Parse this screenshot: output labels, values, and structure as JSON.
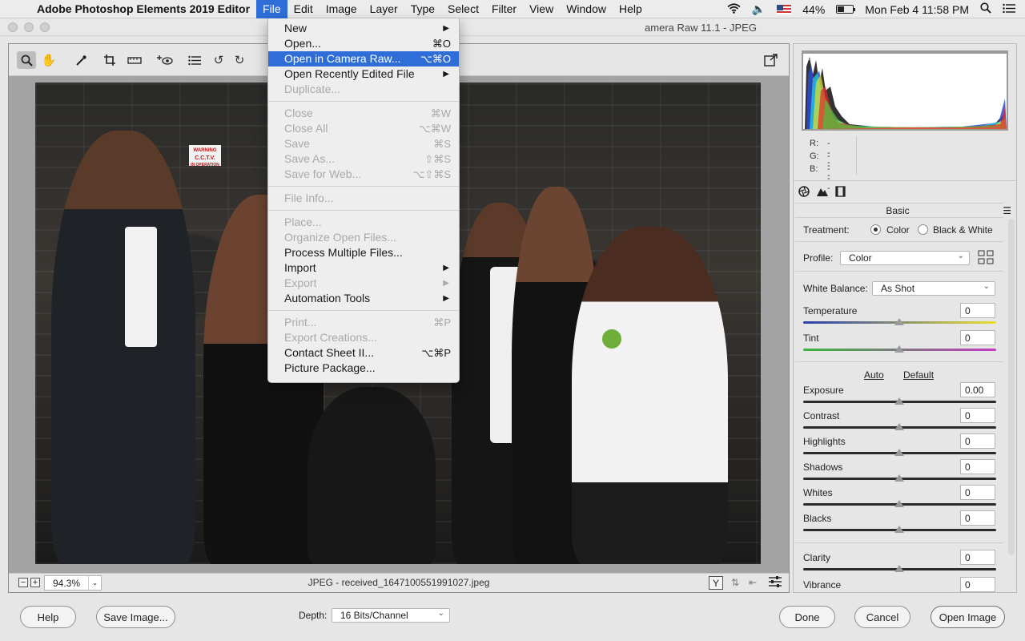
{
  "menubar": {
    "app_name": "Adobe Photoshop Elements 2019 Editor",
    "menus": [
      "File",
      "Edit",
      "Image",
      "Layer",
      "Type",
      "Select",
      "Filter",
      "View",
      "Window",
      "Help"
    ],
    "battery": "44%",
    "clock": "Mon Feb 4  11:58 PM"
  },
  "window": {
    "title": "Camera Raw 11.1  -  JPEG",
    "title_visible": "amera Raw 11.1  -  JPEG"
  },
  "photo": {
    "sign_line1": "WARNING",
    "sign_line2": "C.C.T.V.",
    "sign_line3": "IN OPERATION"
  },
  "status": {
    "zoom": "94.3%",
    "file_label": "JPEG  -  received_1647100551991027.jpeg"
  },
  "histogram": {
    "r_label": "R:",
    "g_label": "G:",
    "b_label": "B:",
    "r_value": "---",
    "g_value": "---",
    "b_value": "---"
  },
  "panel": {
    "title": "Basic",
    "treatment_label": "Treatment:",
    "treatment_options": [
      "Color",
      "Black & White"
    ],
    "treatment_selected": "Color",
    "profile_label": "Profile:",
    "profile_value": "Color",
    "white_balance_label": "White Balance:",
    "white_balance_value": "As Shot",
    "auto_label": "Auto",
    "default_label": "Default",
    "sliders": [
      {
        "name": "Temperature",
        "value": "0"
      },
      {
        "name": "Tint",
        "value": "0"
      },
      {
        "name": "Exposure",
        "value": "0.00"
      },
      {
        "name": "Contrast",
        "value": "0"
      },
      {
        "name": "Highlights",
        "value": "0"
      },
      {
        "name": "Shadows",
        "value": "0"
      },
      {
        "name": "Whites",
        "value": "0"
      },
      {
        "name": "Blacks",
        "value": "0"
      },
      {
        "name": "Clarity",
        "value": "0"
      },
      {
        "name": "Vibrance",
        "value": "0"
      }
    ]
  },
  "bottom": {
    "help": "Help",
    "save_image": "Save Image...",
    "depth_label": "Depth:",
    "depth_value": "16 Bits/Channel",
    "done": "Done",
    "cancel": "Cancel",
    "open_image": "Open Image"
  },
  "file_menu": {
    "items": [
      {
        "label": "New",
        "shortcut": "",
        "submenu": true,
        "disabled": false
      },
      {
        "label": "Open...",
        "shortcut": "⌘O",
        "submenu": false,
        "disabled": false
      },
      {
        "label": "Open in Camera Raw...",
        "shortcut": "⌥⌘O",
        "submenu": false,
        "disabled": false,
        "highlighted": true
      },
      {
        "label": "Open Recently Edited File",
        "shortcut": "",
        "submenu": true,
        "disabled": false
      },
      {
        "label": "Duplicate...",
        "shortcut": "",
        "submenu": false,
        "disabled": true
      },
      {
        "separator": true
      },
      {
        "label": "Close",
        "shortcut": "⌘W",
        "submenu": false,
        "disabled": true
      },
      {
        "label": "Close All",
        "shortcut": "⌥⌘W",
        "submenu": false,
        "disabled": true
      },
      {
        "label": "Save",
        "shortcut": "⌘S",
        "submenu": false,
        "disabled": true
      },
      {
        "label": "Save As...",
        "shortcut": "⇧⌘S",
        "submenu": false,
        "disabled": true
      },
      {
        "label": "Save for Web...",
        "shortcut": "⌥⇧⌘S",
        "submenu": false,
        "disabled": true
      },
      {
        "separator": true
      },
      {
        "label": "File Info...",
        "shortcut": "",
        "submenu": false,
        "disabled": true
      },
      {
        "separator": true
      },
      {
        "label": "Place...",
        "shortcut": "",
        "submenu": false,
        "disabled": true
      },
      {
        "label": "Organize Open Files...",
        "shortcut": "",
        "submenu": false,
        "disabled": true
      },
      {
        "label": "Process Multiple Files...",
        "shortcut": "",
        "submenu": false,
        "disabled": false
      },
      {
        "label": "Import",
        "shortcut": "",
        "submenu": true,
        "disabled": false
      },
      {
        "label": "Export",
        "shortcut": "",
        "submenu": true,
        "disabled": true
      },
      {
        "label": "Automation Tools",
        "shortcut": "",
        "submenu": true,
        "disabled": false
      },
      {
        "separator": true
      },
      {
        "label": "Print...",
        "shortcut": "⌘P",
        "submenu": false,
        "disabled": true
      },
      {
        "label": "Export Creations...",
        "shortcut": "",
        "submenu": false,
        "disabled": true
      },
      {
        "label": "Contact Sheet II...",
        "shortcut": "⌥⌘P",
        "submenu": false,
        "disabled": false
      },
      {
        "label": "Picture Package...",
        "shortcut": "",
        "submenu": false,
        "disabled": false
      }
    ]
  },
  "colors": {
    "menu_highlight": "#2f6ed8",
    "panel_bg": "#e6e6e6",
    "canvas_bg": "#a3a3a3"
  }
}
